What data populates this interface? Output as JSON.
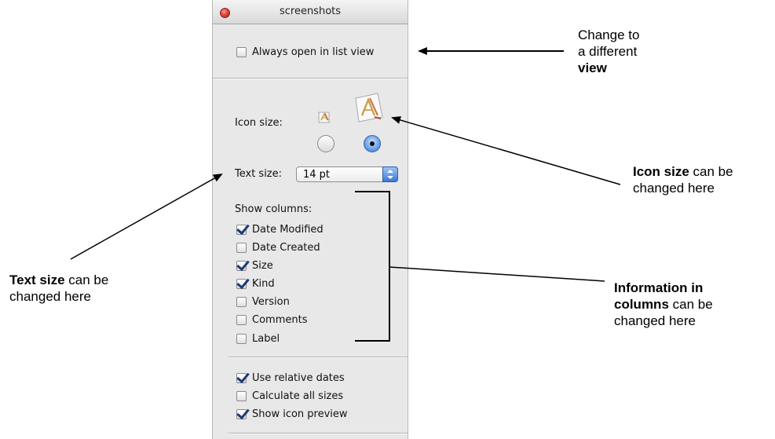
{
  "window": {
    "title": "screenshots"
  },
  "view_options": {
    "always_open_list": {
      "label": "Always open in list view",
      "checked": false
    },
    "icon_size": {
      "label": "Icon size:",
      "selected": "large"
    },
    "text_size": {
      "label": "Text size:",
      "value": "14 pt"
    },
    "show_columns": {
      "label": "Show columns:",
      "items": [
        {
          "label": "Date Modified",
          "checked": true
        },
        {
          "label": "Date Created",
          "checked": false
        },
        {
          "label": "Size",
          "checked": true
        },
        {
          "label": "Kind",
          "checked": true
        },
        {
          "label": "Version",
          "checked": false
        },
        {
          "label": "Comments",
          "checked": false
        },
        {
          "label": "Label",
          "checked": false
        }
      ]
    },
    "options": [
      {
        "label": "Use relative dates",
        "checked": true
      },
      {
        "label": "Calculate all sizes",
        "checked": false
      },
      {
        "label": "Show icon preview",
        "checked": true
      }
    ]
  },
  "annotations": {
    "view": {
      "lines": [
        "Change to",
        "a different"
      ],
      "bold": "view"
    },
    "icon_size": {
      "bold": "Icon size",
      "rest": " can be",
      "line2": "changed here"
    },
    "text_size": {
      "bold": "Text size",
      "rest": " can be",
      "line2": "changed here"
    },
    "columns": {
      "bold1": "Information in",
      "bold2": "columns",
      "rest": " can be",
      "line3": "changed here"
    }
  },
  "colors": {
    "accent": "#3a78d6",
    "check": "#1a3a78",
    "close": "#e0443a"
  },
  "icons": [
    "close-icon",
    "document-icon",
    "chevron-updown-icon"
  ]
}
